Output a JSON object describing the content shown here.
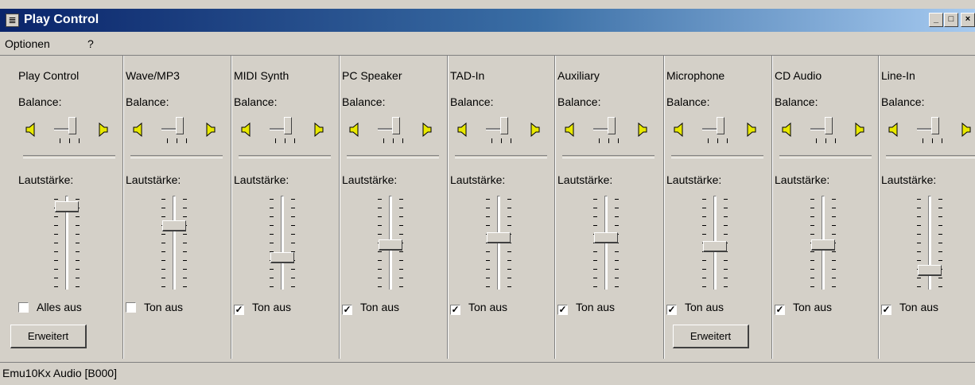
{
  "window": {
    "title": "Play Control",
    "icon": "mixer-icon",
    "controls": {
      "minimize": "_",
      "maximize": "□",
      "close": "×"
    }
  },
  "menu": [
    "Optionen",
    "?"
  ],
  "labels": {
    "balance": "Balance:",
    "volume": "Lautstärke:"
  },
  "channels": [
    {
      "name": "Play Control",
      "mute_label": "Alles aus",
      "muted": false,
      "volume_level": 0.93,
      "advanced_label": "Erweitert"
    },
    {
      "name": "Wave/MP3",
      "mute_label": "Ton aus",
      "muted": false,
      "volume_level": 0.7
    },
    {
      "name": "MIDI Synth",
      "mute_label": "Ton aus",
      "muted": true,
      "volume_level": 0.32
    },
    {
      "name": "PC Speaker",
      "mute_label": "Ton aus",
      "muted": true,
      "volume_level": 0.47
    },
    {
      "name": "TAD-In",
      "mute_label": "Ton aus",
      "muted": true,
      "volume_level": 0.56
    },
    {
      "name": "Auxiliary",
      "mute_label": "Ton aus",
      "muted": true,
      "volume_level": 0.56
    },
    {
      "name": "Microphone",
      "mute_label": "Ton aus",
      "muted": true,
      "volume_level": 0.45,
      "advanced_label": "Erweitert"
    },
    {
      "name": "CD Audio",
      "mute_label": "Ton aus",
      "muted": true,
      "volume_level": 0.47
    },
    {
      "name": "Line-In",
      "mute_label": "Ton aus",
      "muted": true,
      "volume_level": 0.16
    }
  ],
  "status": "Emu10Kx Audio [B000]",
  "colors": {
    "face": "#d4d0c8",
    "title_start": "#0a246a",
    "title_end": "#a6caf0",
    "speaker": "#e8e800"
  }
}
